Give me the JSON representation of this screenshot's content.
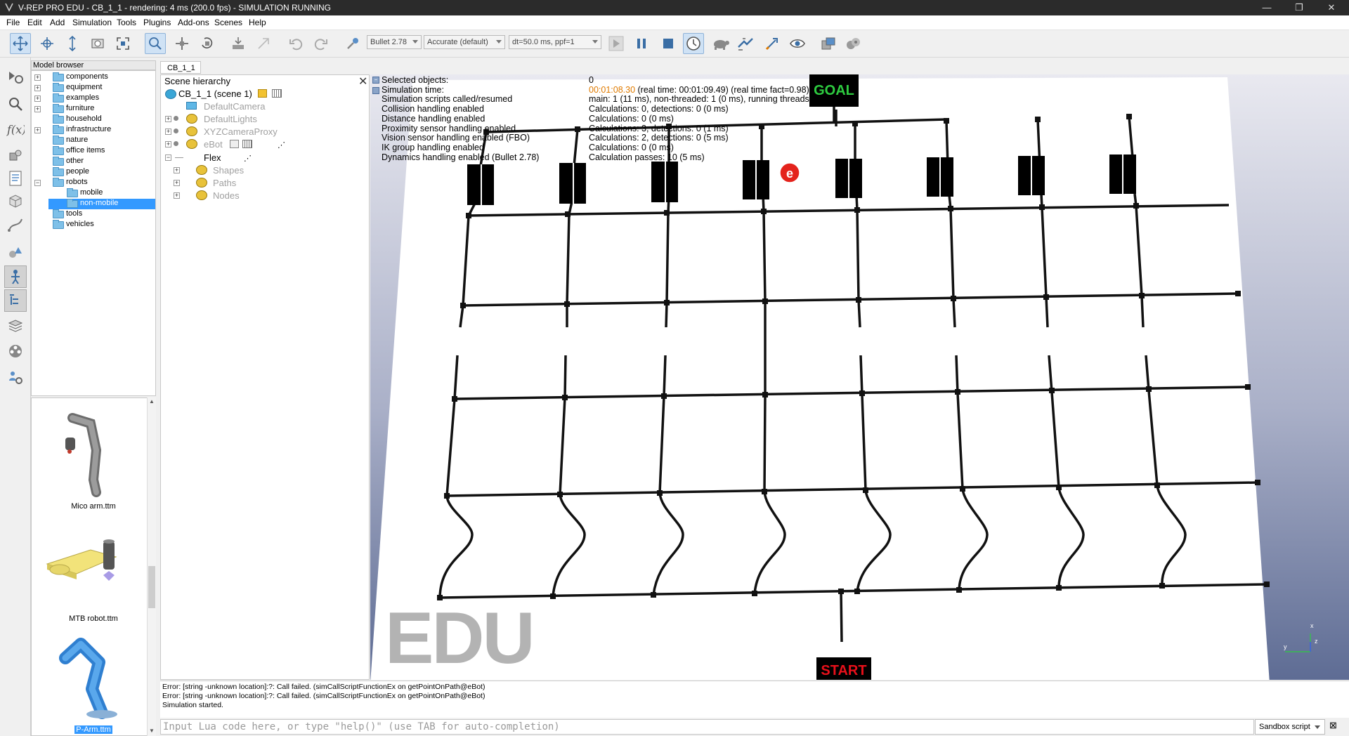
{
  "window": {
    "title": "V-REP PRO EDU - CB_1_1 - rendering: 4 ms (200.0 fps) - SIMULATION RUNNING",
    "app_icon": "v-rep-icon",
    "controls": [
      "minimize-icon",
      "restore-icon",
      "close-icon"
    ],
    "minimize_glyph": "—",
    "restore_glyph": "❐",
    "close_glyph": "✕"
  },
  "menu": [
    "File",
    "Edit",
    "Add",
    "Simulation",
    "Tools",
    "Plugins",
    "Add-ons",
    "Scenes",
    "Help"
  ],
  "toolbar": {
    "engine": "Bullet 2.78",
    "accuracy": "Accurate (default)",
    "timestep": "dt=50.0 ms, ppf=1"
  },
  "model_browser": {
    "header": "Model browser",
    "items": [
      {
        "label": "components",
        "expandable": true
      },
      {
        "label": "equipment",
        "expandable": true
      },
      {
        "label": "examples",
        "expandable": true
      },
      {
        "label": "furniture",
        "expandable": true
      },
      {
        "label": "household",
        "expandable": false
      },
      {
        "label": "infrastructure",
        "expandable": true
      },
      {
        "label": "nature",
        "expandable": false
      },
      {
        "label": "office items",
        "expandable": false
      },
      {
        "label": "other",
        "expandable": false
      },
      {
        "label": "people",
        "expandable": false
      },
      {
        "label": "robots",
        "expandable": true
      },
      {
        "label": "mobile",
        "expandable": false
      },
      {
        "label": "non-mobile",
        "expandable": false,
        "selected": true
      },
      {
        "label": "tools",
        "expandable": false
      },
      {
        "label": "vehicles",
        "expandable": false
      }
    ],
    "thumbnails": [
      "Mico arm.ttm",
      "MTB robot.ttm",
      "P-Arm.ttm"
    ]
  },
  "scene_tab": "CB_1_1",
  "scene_hierarchy": {
    "header": "Scene hierarchy",
    "close_glyph": "✕",
    "items": [
      {
        "label": "CB_1_1 (scene 1)",
        "greyed": false
      },
      {
        "label": "DefaultCamera",
        "greyed": true
      },
      {
        "label": "DefaultLights",
        "greyed": true
      },
      {
        "label": "XYZCameraProxy",
        "greyed": true
      },
      {
        "label": "eBot",
        "greyed": true
      },
      {
        "label": "Flex",
        "greyed": false
      },
      {
        "label": "Shapes",
        "greyed": true
      },
      {
        "label": "Paths",
        "greyed": true
      },
      {
        "label": "Nodes",
        "greyed": true
      }
    ]
  },
  "info": {
    "labels": [
      "Selected objects:",
      "Simulation time:",
      "Simulation scripts called/resumed",
      "Collision handling enabled",
      "Distance handling enabled",
      "Proximity sensor handling enabled",
      "Vision sensor handling enabled (FBO)",
      "IK group handling enabled",
      "Dynamics handling enabled (Bullet 2.78)"
    ],
    "sim_time": "00:01:08.30",
    "sim_time_rest": " (real time: 00:01:09.49) (real time fact=0.98)",
    "values": [
      "0",
      "",
      "main: 1 (11 ms), non-threaded: 1 (0 ms), running threads: 0 (0 ms)",
      "Calculations: 0, detections: 0 (0 ms)",
      "Calculations: 0 (0 ms)",
      "Calculations: 3, detections: 0 (1 ms)",
      "Calculations: 2, detections: 0 (5 ms)",
      "Calculations: 0 (0 ms)",
      "Calculation passes: 10 (5 ms)"
    ],
    "sim_time_color": "#e07b00"
  },
  "arena": {
    "goal_label": "GOAL",
    "start_label": "START",
    "goal_color": "#2ecc40",
    "start_color": "#e8101a"
  },
  "watermark": "EDU",
  "axes": {
    "x": "x",
    "y": "y",
    "z": "z"
  },
  "console": {
    "lines": [
      "Error: [string -unknown location]:?: Call failed. (simCallScriptFunctionEx on getPointOnPath@eBot)",
      "Error: [string -unknown location]:?: Call failed. (simCallScriptFunctionEx on getPointOnPath@eBot)",
      "Simulation started."
    ],
    "input_placeholder": "Input Lua code here, or type \"help()\" (use TAB for auto-completion)",
    "script_selector": "Sandbox script"
  }
}
